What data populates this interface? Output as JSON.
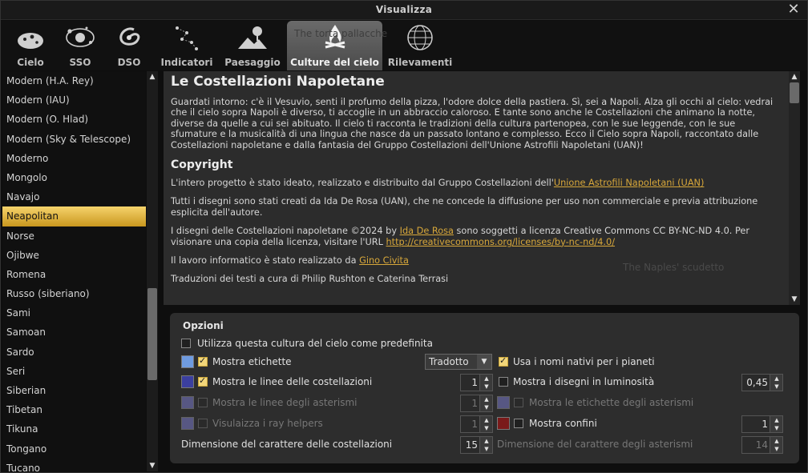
{
  "window": {
    "title": "Visualizza",
    "close_glyph": "✕"
  },
  "tabs": [
    {
      "label": "Cielo",
      "icon": "sky-icon"
    },
    {
      "label": "SSO",
      "icon": "solar-system-icon"
    },
    {
      "label": "DSO",
      "icon": "galaxy-icon"
    },
    {
      "label": "Indicatori",
      "icon": "constellation-markings-icon"
    },
    {
      "label": "Paesaggio",
      "icon": "landscape-icon"
    },
    {
      "label": "Culture del cielo",
      "icon": "campfire-icon",
      "active": true
    },
    {
      "label": "Rilevamenti",
      "icon": "survey-sphere-icon"
    }
  ],
  "ghost_texts": {
    "tab_area": "The torta pallacche",
    "info_area": "The Naples' scudetto"
  },
  "sky_cultures": {
    "items": [
      "Modern (H.A. Rey)",
      "Modern (IAU)",
      "Modern (O. Hlad)",
      "Modern (Sky & Telescope)",
      "Moderno",
      "Mongolo",
      "Navajo",
      "Neapolitan",
      "Norse",
      "Ojibwe",
      "Romena",
      "Russo (siberiano)",
      "Sami",
      "Samoan",
      "Sardo",
      "Seri",
      "Siberian",
      "Tibetan",
      "Tikuna",
      "Tongano",
      "Tucano"
    ],
    "selected": "Neapolitan",
    "scroll_position": 0.72
  },
  "info": {
    "title": "Le Costellazioni Napoletane",
    "intro": "Guardati intorno: c'è il Vesuvio, senti il profumo della pizza, l'odore dolce della pastiera. Sì, sei a Napoli. Alza gli occhi al cielo: vedrai che il cielo sopra Napoli è diverso, ti accoglie in un abbraccio caloroso. E tante sono anche le Costellazioni che animano la notte, diverse da quelle a cui sei abituato. Il cielo ti racconta le tradizioni della cultura partenopea, con le sue leggende, con le sue sfumature e la musicalità di una lingua che nasce da un passato lontano e complesso. Ecco il Cielo sopra Napoli, raccontato dalle Costellazioni napoletane e dalla fantasia del Gruppo Costellazioni dell'Unione Astrofili Napoletani (UAN)!",
    "copyright_heading": "Copyright",
    "p1_text": "L'intero progetto è stato ideato, realizzato e distribuito dal Gruppo Costellazioni dell'",
    "p1_link": "Unione Astrofili Napoletani (UAN)",
    "p2_text": "Tutti i disegni sono stati creati da Ida De Rosa (UAN), che ne concede la diffusione per uso non commerciale e previa attribuzione esplicita dell'autore.",
    "p3_a": "I disegni delle Costellazioni napoletane ©2024 by ",
    "p3_link1": "Ida De Rosa",
    "p3_b": " sono soggetti a licenza Creative Commons CC BY-NC-ND 4.0. Per visionare una copia della licenza, visitare l'URL ",
    "p3_link2": "http://creativecommons.org/licenses/by-nc-nd/4.0/",
    "p4_text": "Il lavoro informatico è stato realizzato da ",
    "p4_link": "Gino Civita",
    "p5_text": "Traduzioni dei testi a cura di Philip Rushton e Caterina Terrasi",
    "scroll_position": 0.0
  },
  "options": {
    "title": "Opzioni",
    "use_default": {
      "label": "Utilizza questa cultura del cielo come predefinita",
      "checked": false
    },
    "show_labels": {
      "label": "Mostra etichette",
      "checked": true,
      "color": "#6f9be0"
    },
    "labels_mode": {
      "value": "Tradotto"
    },
    "native_planets": {
      "label": "Usa i nomi nativi per i pianeti",
      "checked": true
    },
    "constellation_lines": {
      "label": "Mostra le linee delle costellazioni",
      "checked": true,
      "color": "#3b3f9f",
      "width": "1"
    },
    "art_brightness": {
      "label": "Mostra i disegni in luminosità",
      "checked": false,
      "value": "0,45"
    },
    "asterism_lines": {
      "label": "Mostra le linee degli asterismi",
      "checked": false,
      "color": "#6a6aa8",
      "width": "1"
    },
    "asterism_labels": {
      "label": "Mostra le etichette degli asterismi",
      "checked": false,
      "color": "#6a6aa8"
    },
    "ray_helpers": {
      "label": "Visulaizza i ray helpers",
      "checked": false,
      "color": "#6a6aa8",
      "width": "1"
    },
    "boundaries": {
      "label": "Mostra confini",
      "checked": false,
      "color": "#7a1a1a",
      "width": "1"
    },
    "constellation_font": {
      "label": "Dimensione del carattere delle costellazioni",
      "value": "15"
    },
    "asterism_font": {
      "label": "Dimensione del carattere degli asterismi",
      "value": "14"
    }
  }
}
